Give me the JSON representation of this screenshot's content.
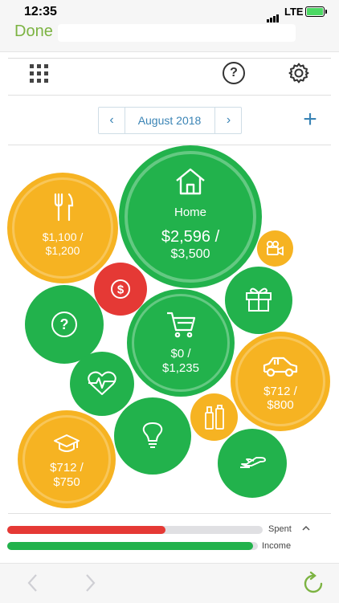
{
  "status_bar": {
    "time": "12:35",
    "network": "LTE"
  },
  "browser": {
    "done_label": "Done"
  },
  "month_nav": {
    "month": "August 2018",
    "prev": "‹",
    "next": "›",
    "add": "+"
  },
  "toolbar": {
    "help_label": "?"
  },
  "budgets": [
    {
      "name": "Dining",
      "icon": "fork-knife-icon",
      "spent": "$1,100 /",
      "budget": "$1,200",
      "color": "#f6b322"
    },
    {
      "name": "Home",
      "icon": "house-icon",
      "label": "Home",
      "spent": "$2,596 /",
      "budget": "$3,500",
      "color": "#22b24c"
    },
    {
      "name": "Entertainment",
      "icon": "video-camera-icon",
      "color": "#f6b322"
    },
    {
      "name": "Finance",
      "icon": "dollar-icon",
      "color": "#e53935"
    },
    {
      "name": "Uncategorized",
      "icon": "question-icon",
      "label": "?",
      "color": "#22b24c"
    },
    {
      "name": "Gifts",
      "icon": "gift-icon",
      "color": "#22b24c"
    },
    {
      "name": "Shopping",
      "icon": "shopping-cart-icon",
      "spent": "$0 /",
      "budget": "$1,235",
      "color": "#22b24c"
    },
    {
      "name": "Health",
      "icon": "heart-pulse-icon",
      "color": "#22b24c"
    },
    {
      "name": "Auto",
      "icon": "car-icon",
      "spent": "$712 /",
      "budget": "$800",
      "color": "#f6b322"
    },
    {
      "name": "Personal Care",
      "icon": "toiletries-icon",
      "color": "#f6b322"
    },
    {
      "name": "Utilities",
      "icon": "light-bulb-icon",
      "color": "#22b24c"
    },
    {
      "name": "Education",
      "icon": "graduation-cap-icon",
      "spent": "$712 /",
      "budget": "$750",
      "color": "#f6b322"
    },
    {
      "name": "Travel",
      "icon": "airplane-icon",
      "color": "#22b24c"
    }
  ],
  "summary": {
    "spent_label": "Spent",
    "income_label": "Income",
    "spent_fraction": 0.62,
    "income_fraction": 0.98,
    "spent_color": "#e53935",
    "income_color": "#22b24c"
  }
}
